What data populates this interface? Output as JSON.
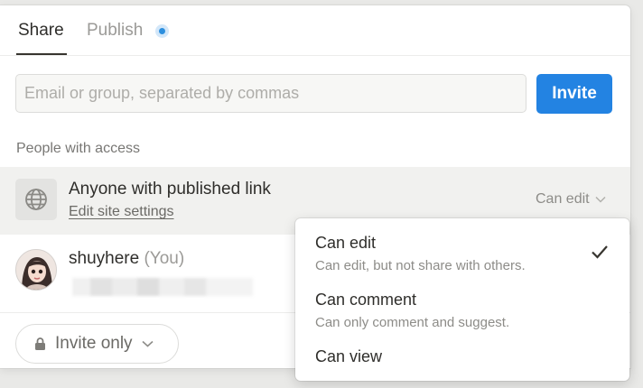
{
  "tabs": {
    "share": "Share",
    "publish": "Publish"
  },
  "invite": {
    "placeholder": "Email or group, separated by commas",
    "button": "Invite"
  },
  "section_label": "People with access",
  "access_link": {
    "icon": "globe-icon",
    "title": "Anyone with published link",
    "link": "Edit site settings",
    "permission": "Can edit"
  },
  "user": {
    "name": "shuyhere",
    "you": "(You)"
  },
  "footer": {
    "invite_only": "Invite only"
  },
  "menu": {
    "items": [
      {
        "title": "Can edit",
        "desc": "Can edit, but not share with others.",
        "checked": true
      },
      {
        "title": "Can comment",
        "desc": "Can only comment and suggest.",
        "checked": false
      },
      {
        "title": "Can view",
        "desc": "",
        "checked": false
      }
    ]
  },
  "colors": {
    "accent": "#2383e2",
    "text": "#37352f",
    "muted": "#787774",
    "row_highlight": "#f1f1ef"
  }
}
